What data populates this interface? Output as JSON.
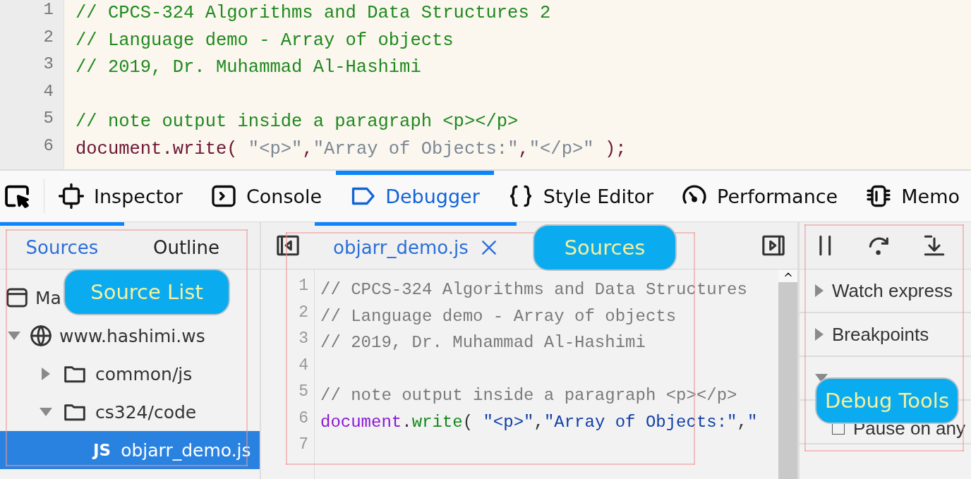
{
  "top_editor": {
    "lines": [
      {
        "number": "1",
        "tokens": [
          {
            "kind": "comment",
            "text": "// CPCS-324 Algorithms and Data Structures 2"
          }
        ]
      },
      {
        "number": "2",
        "tokens": [
          {
            "kind": "comment",
            "text": "// Language demo - Array of objects"
          }
        ]
      },
      {
        "number": "3",
        "tokens": [
          {
            "kind": "comment",
            "text": "// 2019, Dr. Muhammad Al-Hashimi"
          }
        ]
      },
      {
        "number": "4"
      },
      {
        "number": "5",
        "tokens": [
          {
            "kind": "comment",
            "text": "// note output inside a paragraph <p></p>"
          }
        ]
      },
      {
        "number": "6",
        "tokens": [
          {
            "kind": "object",
            "text": "document"
          },
          {
            "kind": "punct",
            "text": "."
          },
          {
            "kind": "method",
            "text": "write"
          },
          {
            "kind": "punct",
            "text": "( "
          },
          {
            "kind": "string",
            "text": "\"<p>\""
          },
          {
            "kind": "punct",
            "text": ","
          },
          {
            "kind": "string",
            "text": "\"Array of Objects:\""
          },
          {
            "kind": "punct",
            "text": ","
          },
          {
            "kind": "string",
            "text": "\"</p>\""
          },
          {
            "kind": "punct",
            "text": " );"
          }
        ]
      }
    ]
  },
  "toolbar": {
    "tabs": [
      {
        "kind": "inspector",
        "label": "Inspector",
        "selected": false
      },
      {
        "kind": "console",
        "label": "Console",
        "selected": false
      },
      {
        "kind": "debugger",
        "label": "Debugger",
        "selected": true
      },
      {
        "kind": "style",
        "label": "Style Editor",
        "selected": false
      },
      {
        "kind": "performance",
        "label": "Performance",
        "selected": false
      },
      {
        "kind": "memory",
        "label": "Memo",
        "selected": false
      }
    ]
  },
  "source_pane": {
    "tabs": [
      {
        "label": "Sources",
        "selected": true
      },
      {
        "label": "Outline",
        "selected": false
      }
    ],
    "tree": [
      {
        "kind": "thread",
        "label": "Ma",
        "selected": false,
        "children": [
          {
            "kind": "domain",
            "label": "www.hashimi.ws",
            "expanded": true,
            "selected": false,
            "children": [
              {
                "kind": "folder",
                "label": "common/js",
                "expanded": false,
                "selected": false
              },
              {
                "kind": "folder",
                "label": "cs324/code",
                "expanded": true,
                "selected": false,
                "children": [
                  {
                    "kind": "file",
                    "badge": "JS",
                    "label": "objarr_demo.js",
                    "selected": true
                  }
                ]
              }
            ]
          }
        ]
      }
    ],
    "callout": "Source List"
  },
  "editor_pane": {
    "tabs": [
      {
        "label": "objarr_demo.js",
        "selected": true
      }
    ],
    "lines": [
      {
        "number": "1",
        "tokens": [
          {
            "kind": "comment",
            "text": "// CPCS-324 Algorithms and Data Structures"
          }
        ]
      },
      {
        "number": "2",
        "tokens": [
          {
            "kind": "comment",
            "text": "// Language demo - Array of objects"
          }
        ]
      },
      {
        "number": "3",
        "tokens": [
          {
            "kind": "comment",
            "text": "// 2019, Dr. Muhammad Al-Hashimi"
          }
        ]
      },
      {
        "number": "4"
      },
      {
        "number": "5",
        "tokens": [
          {
            "kind": "comment",
            "text": "// note output inside a paragraph <p></p>"
          }
        ]
      },
      {
        "number": "6",
        "tokens": [
          {
            "kind": "object",
            "text": "document"
          },
          {
            "kind": "punct",
            "text": "."
          },
          {
            "kind": "method",
            "text": "write"
          },
          {
            "kind": "punct",
            "text": "( "
          },
          {
            "kind": "string",
            "text": "\"<p>\""
          },
          {
            "kind": "punct",
            "text": ","
          },
          {
            "kind": "string",
            "text": "\"Array of Objects:\""
          },
          {
            "kind": "punct",
            "text": ","
          },
          {
            "kind": "string",
            "text": "\""
          }
        ]
      },
      {
        "number": "7"
      }
    ],
    "callout": "Sources"
  },
  "debug_pane": {
    "sections": [
      {
        "kind": "section",
        "label": "Watch express",
        "expanded": false
      },
      {
        "kind": "section",
        "label": "Breakpoints",
        "expanded": false
      },
      {
        "kind": "section",
        "expanded": true
      },
      {
        "kind": "checkbox",
        "label": "Pause on any",
        "checked": false
      }
    ],
    "callout": "Debug Tools"
  }
}
